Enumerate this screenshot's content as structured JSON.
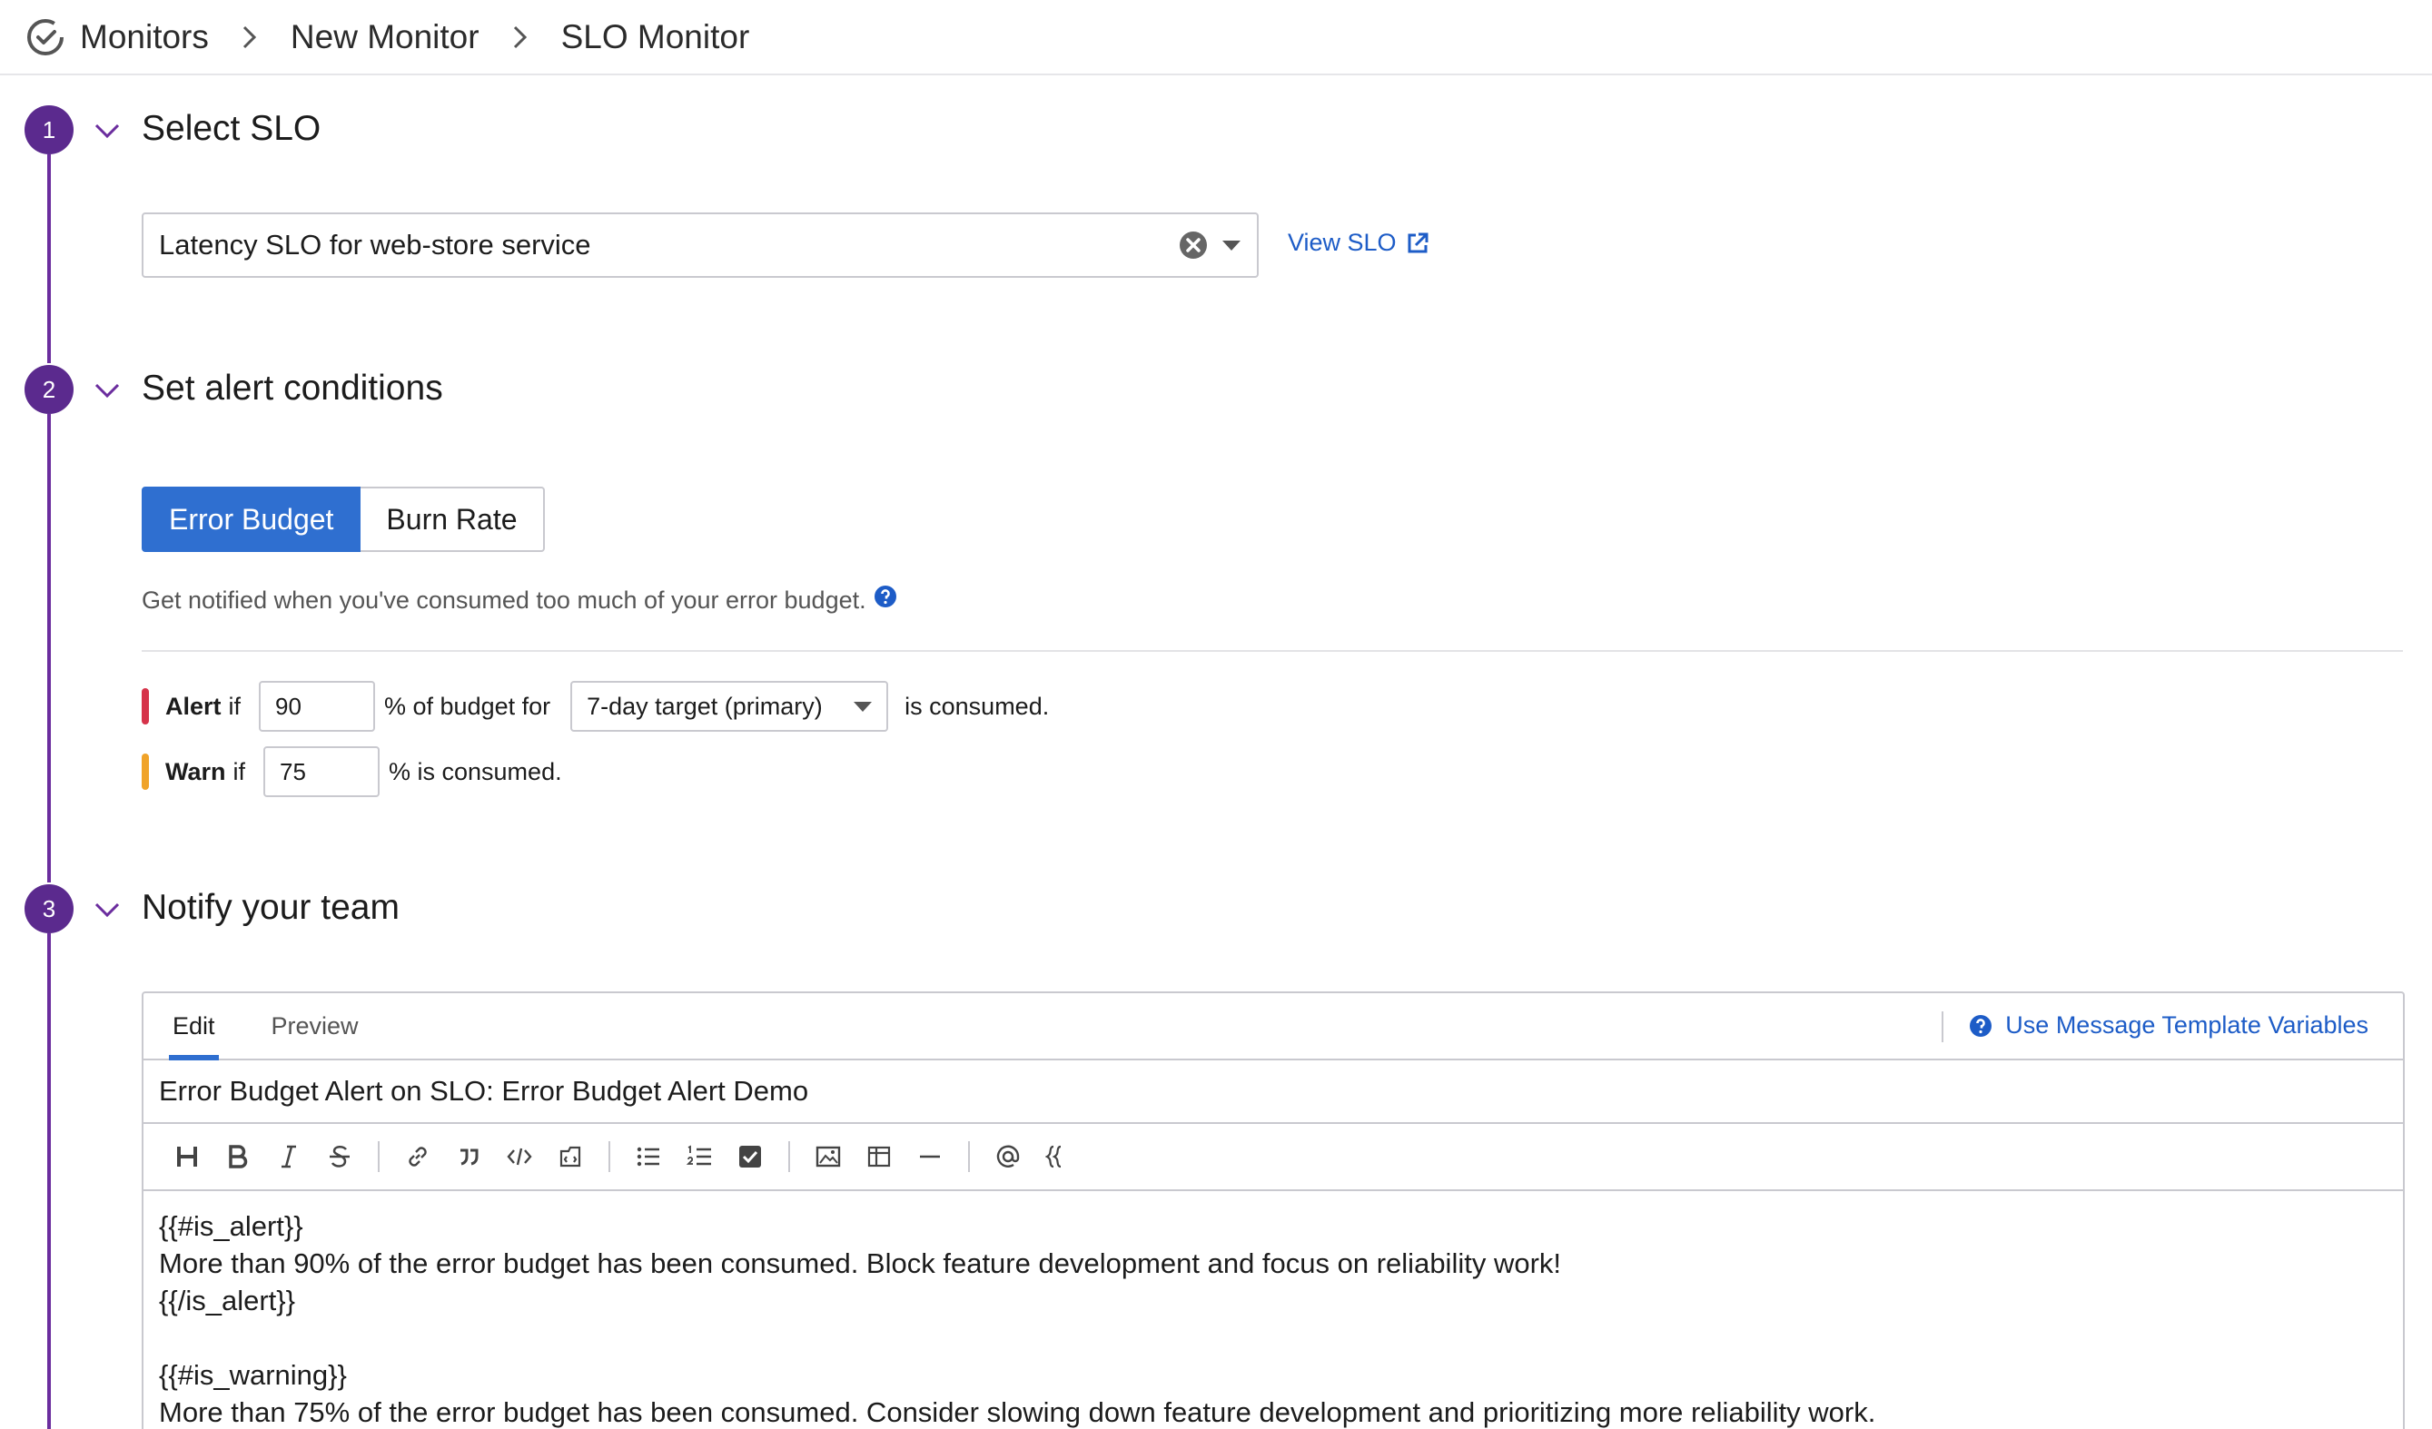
{
  "breadcrumb": {
    "items": [
      "Monitors",
      "New Monitor",
      "SLO Monitor"
    ]
  },
  "steps": [
    {
      "number": "1",
      "title": "Select SLO"
    },
    {
      "number": "2",
      "title": "Set alert conditions"
    },
    {
      "number": "3",
      "title": "Notify your team"
    }
  ],
  "select_slo": {
    "value": "Latency SLO for web-store service",
    "view_link": "View SLO"
  },
  "alert_conditions": {
    "toggle": {
      "active": "Error Budget",
      "inactive": "Burn Rate"
    },
    "hint": "Get notified when you've consumed too much of your error budget.",
    "alert": {
      "label": "Alert",
      "if": "if",
      "value": "90",
      "middle": "% of budget for",
      "target": "7-day target (primary)",
      "suffix": "is consumed."
    },
    "warn": {
      "label": "Warn",
      "if": "if",
      "value": "75",
      "suffix": "% is consumed."
    }
  },
  "notify": {
    "tabs": {
      "edit": "Edit",
      "preview": "Preview"
    },
    "template_link": "Use Message Template Variables",
    "subject": "Error Budget Alert on SLO: Error Budget Alert Demo",
    "toolbar": [
      "heading-icon",
      "bold-icon",
      "italic-icon",
      "strikethrough-icon",
      "link-icon",
      "quote-icon",
      "code-icon",
      "code-block-icon",
      "bullet-list-icon",
      "numbered-list-icon",
      "checkbox-icon",
      "image-icon",
      "table-icon",
      "horizontal-rule-icon",
      "mention-icon",
      "template-variable-icon"
    ],
    "body_lines": [
      "{{#is_alert}}",
      "More than 90% of the error budget has been consumed. Block feature development and focus on reliability work!",
      "{{/is_alert}}",
      "",
      "{{#is_warning}}",
      "More than 75% of the error budget has been consumed. Consider slowing down feature development and prioritizing more reliability work."
    ]
  },
  "colors": {
    "step": "#5b2a8e",
    "primary": "#2f6fd0",
    "link": "#1d5cc7",
    "alert": "#d6334a",
    "warn": "#f0a329"
  }
}
